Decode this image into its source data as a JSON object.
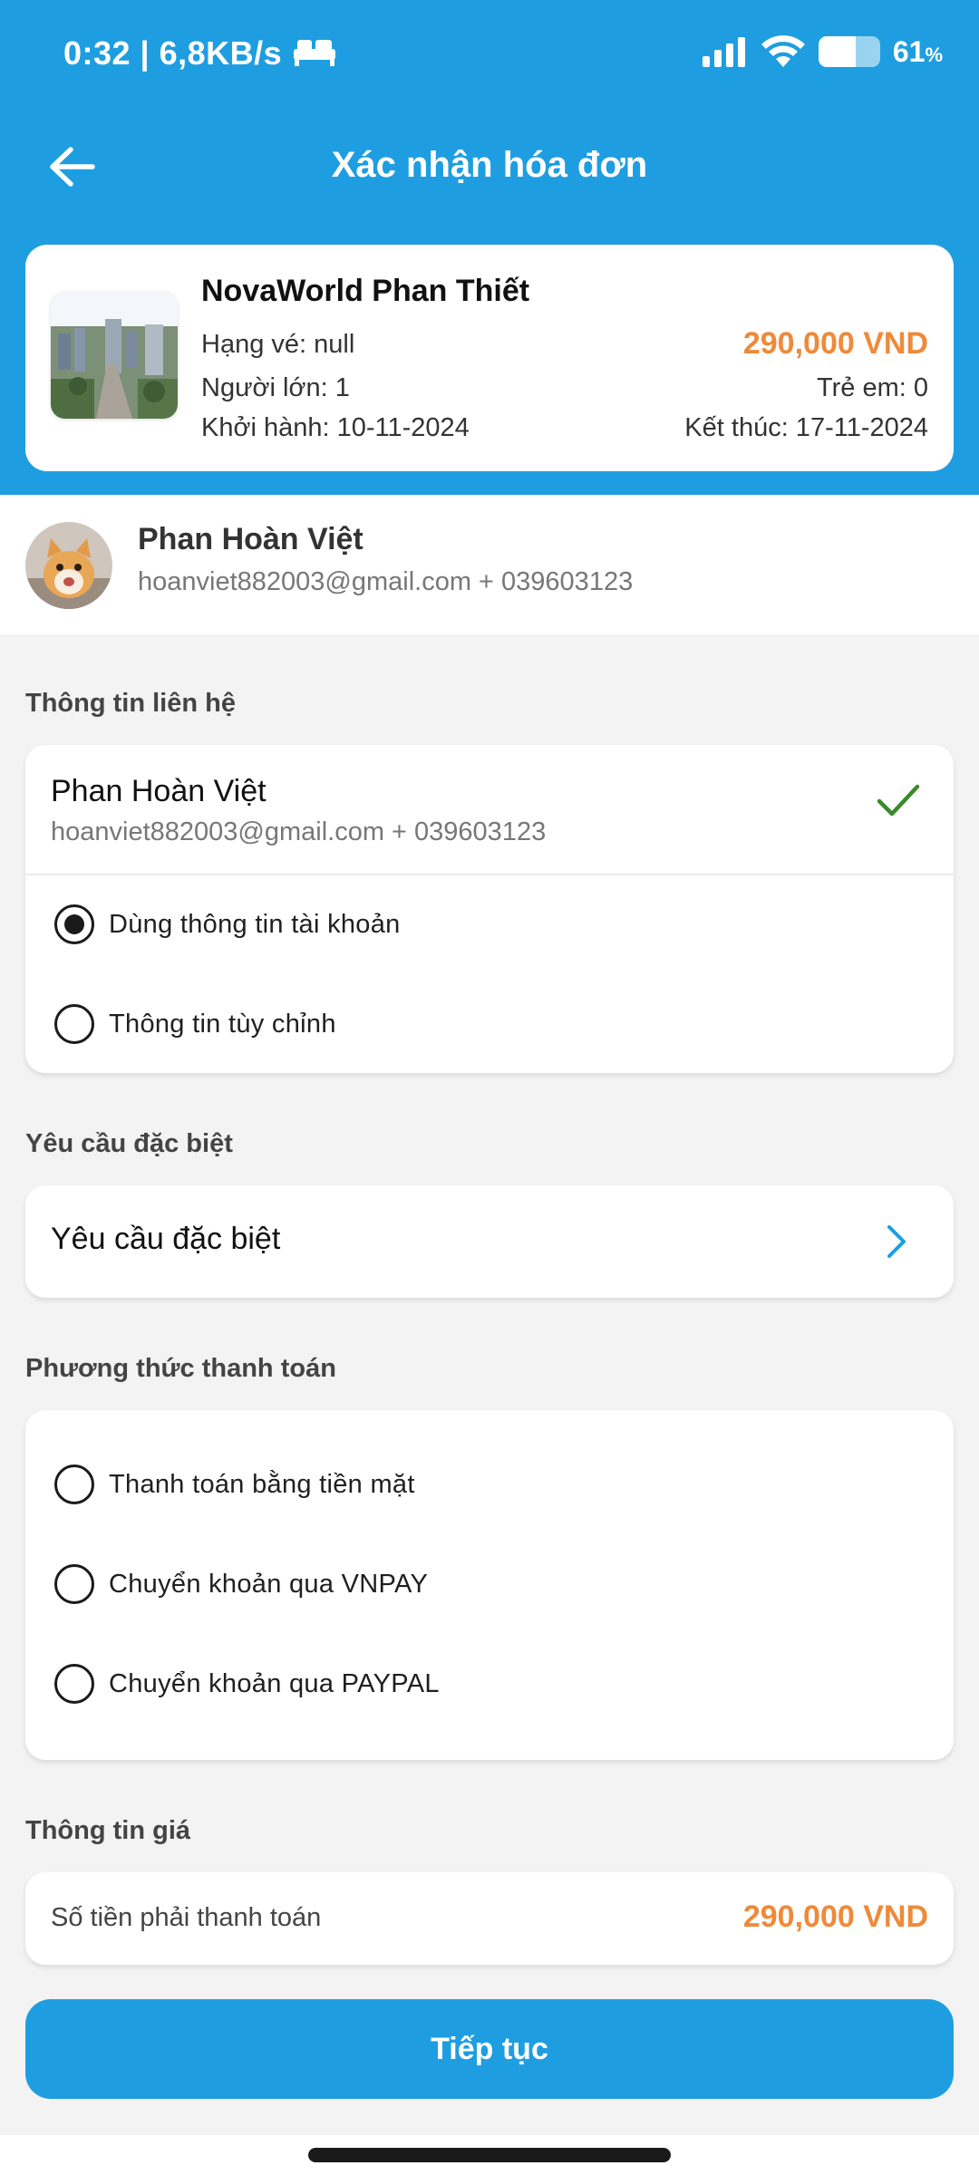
{
  "status_bar": {
    "time_speed": "0:32 | 6,8KB/s",
    "battery_percent": "61",
    "battery_unit": "%",
    "battery_level": 0.61
  },
  "header": {
    "title": "Xác nhận hóa đơn"
  },
  "trip": {
    "name": "NovaWorld Phan Thiết",
    "ticket_class": "Hạng vé: null",
    "price": "290,000 VND",
    "adults": "Người lớn: 1",
    "children": "Trẻ em: 0",
    "start": "Khởi hành: 10-11-2024",
    "end": "Kết thúc: 17-11-2024"
  },
  "user": {
    "name": "Phan Hoàn Việt",
    "contact": "hoanviet882003@gmail.com + 039603123"
  },
  "contact_section": {
    "label": "Thông tin liên hệ",
    "name": "Phan Hoàn Việt",
    "contact": "hoanviet882003@gmail.com + 039603123",
    "options": [
      {
        "label": "Dùng thông tin tài khoản",
        "selected": true
      },
      {
        "label": "Thông tin tùy chỉnh",
        "selected": false
      }
    ]
  },
  "special_section": {
    "label": "Yêu cầu đặc biệt",
    "row_label": "Yêu cầu đặc biệt"
  },
  "payment_section": {
    "label": "Phương thức thanh toán",
    "options": [
      {
        "label": "Thanh toán bằng tiền mặt",
        "selected": false
      },
      {
        "label": "Chuyển khoản qua VNPAY",
        "selected": false
      },
      {
        "label": "Chuyển khoản qua PAYPAL",
        "selected": false
      }
    ]
  },
  "price_section": {
    "label": "Thông tin giá",
    "amount_label": "Số tiền phải thanh toán",
    "amount": "290,000 VND"
  },
  "continue_button": {
    "label": "Tiếp tục"
  },
  "colors": {
    "primary": "#1e9ee0",
    "price": "#ee8a3a",
    "check": "#3a8a2a"
  }
}
